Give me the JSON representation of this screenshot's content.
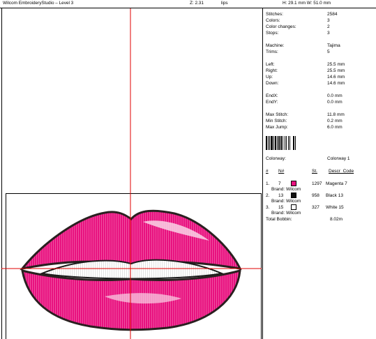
{
  "header": {
    "app_title": "Wilcom EmbroideryStudio – Level 3",
    "zoom": "Z: 2.31",
    "file_name": "lips",
    "dimensions": "H: 29.1 mm   W: 51.0 mm"
  },
  "stats": [
    {
      "label": "Stitches:",
      "value": "2584"
    },
    {
      "label": "Colors:",
      "value": "3"
    },
    {
      "label": "Color changes:",
      "value": "2"
    },
    {
      "label": "Stops:",
      "value": "3"
    }
  ],
  "machine": [
    {
      "label": "Machine:",
      "value": "Tajima"
    },
    {
      "label": "Trims:",
      "value": "5"
    }
  ],
  "extents": [
    {
      "label": "Left:",
      "value": "25.5 mm"
    },
    {
      "label": "Right:",
      "value": "25.5 mm"
    },
    {
      "label": "Up:",
      "value": "14.6 mm"
    },
    {
      "label": "Down:",
      "value": "14.6 mm"
    }
  ],
  "end": [
    {
      "label": "EndX:",
      "value": "0.0 mm"
    },
    {
      "label": "EndY:",
      "value": "0.0 mm"
    }
  ],
  "stitch_lengths": [
    {
      "label": "Max Stitch:",
      "value": "11.8 mm"
    },
    {
      "label": "Min Stitch:",
      "value": "0.2 mm"
    },
    {
      "label": "Max Jump:",
      "value": "6.0 mm"
    }
  ],
  "colorway": {
    "label": "Colorway:",
    "value": "Colorway 1"
  },
  "color_table": {
    "headers": {
      "num": "#",
      "n": "N#",
      "st": "St.",
      "desc": "Descr_Code"
    },
    "rows": [
      {
        "num": "1.",
        "n": "7",
        "st": "1297",
        "desc": "Magenta 7",
        "brand": "Brand: Wilcom",
        "color": "#e8117f"
      },
      {
        "num": "2.",
        "n": "13",
        "st": "958",
        "desc": "Black 13",
        "brand": "Brand: Wilcom",
        "color": "#111111"
      },
      {
        "num": "3.",
        "n": "15",
        "st": "327",
        "desc": "White 15",
        "brand": "Brand: Wilcom",
        "color": "#ffffff"
      }
    ],
    "total_label": "Total Bobbin:",
    "total_value": "8.02m"
  },
  "colors": {
    "accent": "#e00000",
    "lips": "#e8117f",
    "outline": "#2a2020"
  }
}
